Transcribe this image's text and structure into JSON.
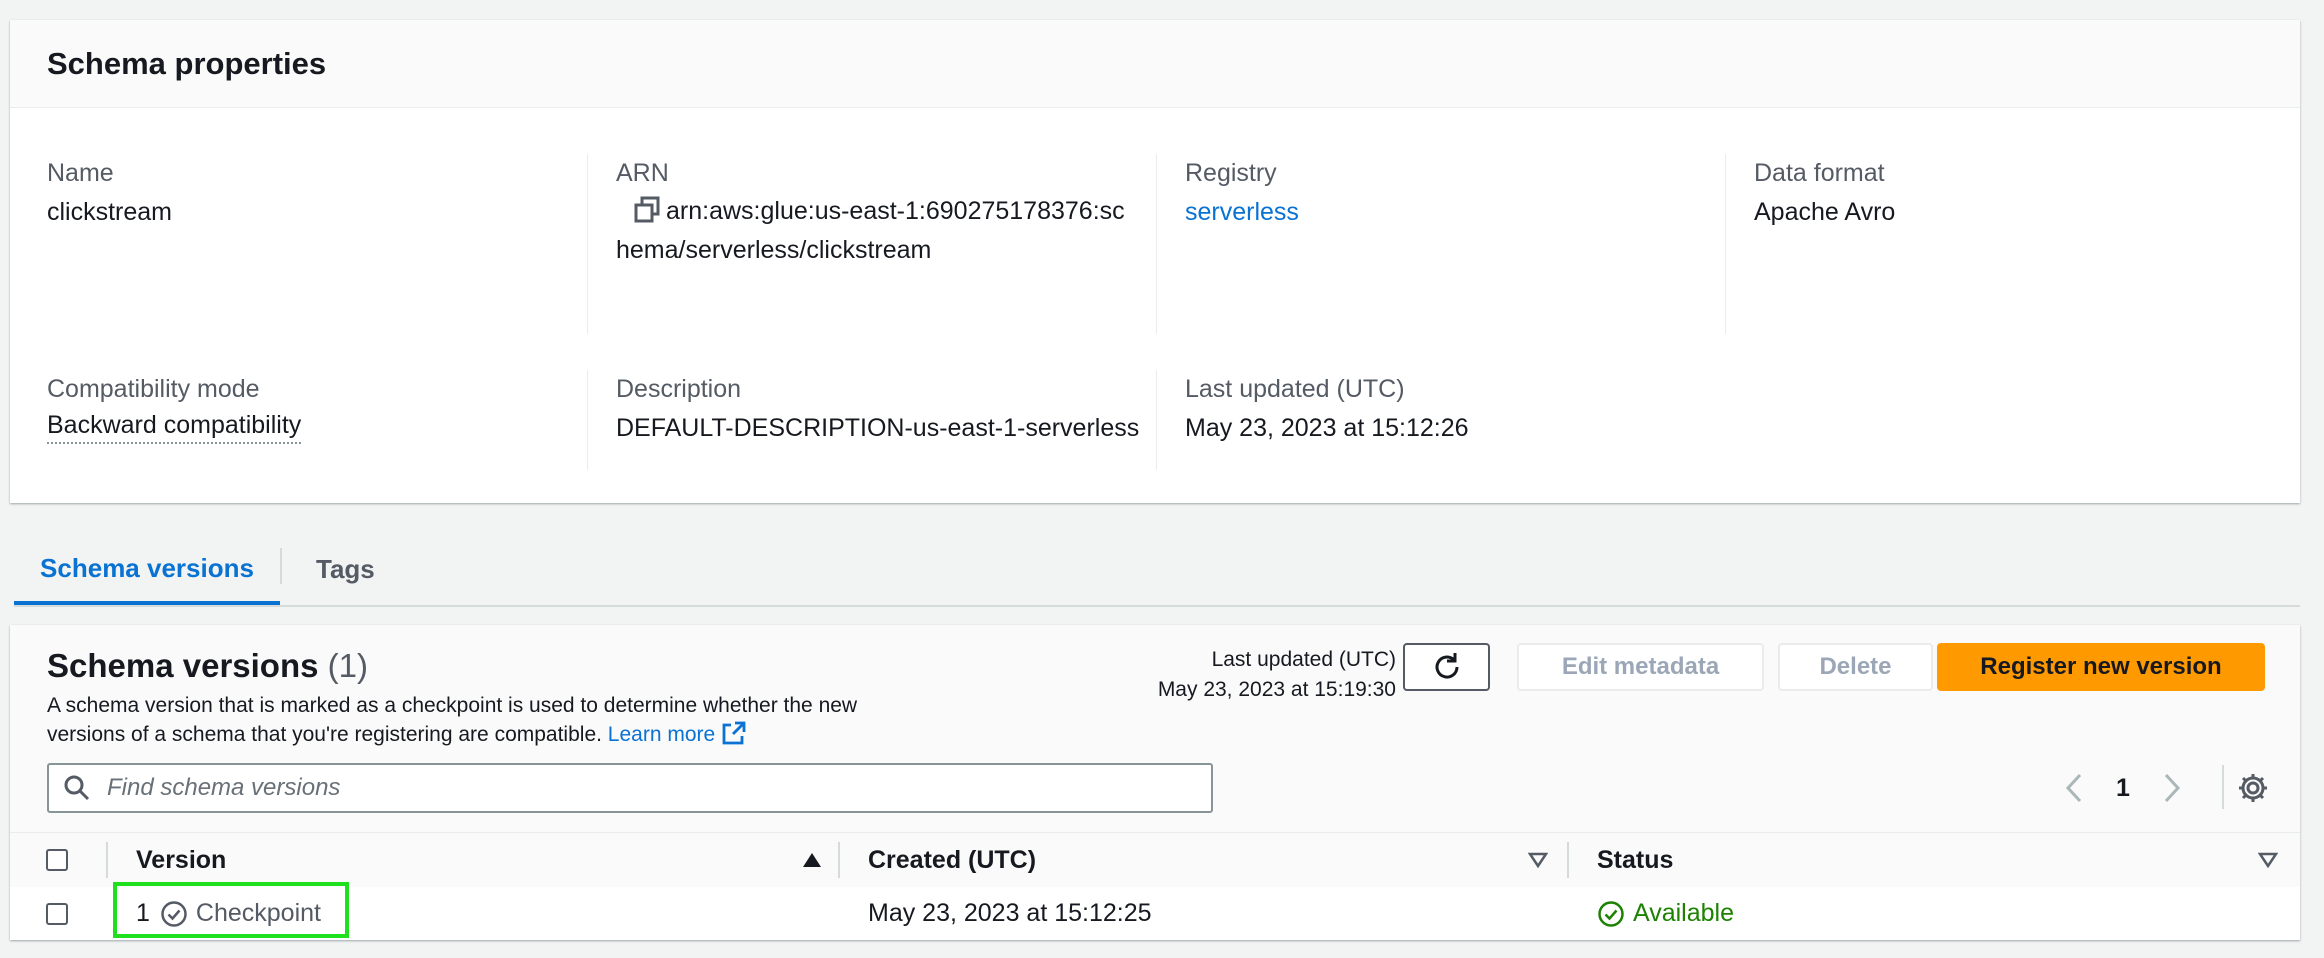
{
  "schema_properties": {
    "title": "Schema properties",
    "name": {
      "label": "Name",
      "value": "clickstream"
    },
    "arn": {
      "label": "ARN",
      "value": "arn:aws:glue:us-east-1:690275178376:schema/serverless/clickstream",
      "copy_icon": "copy-icon"
    },
    "registry": {
      "label": "Registry",
      "value": "serverless"
    },
    "data_format": {
      "label": "Data format",
      "value": "Apache Avro"
    },
    "compatibility_mode": {
      "label": "Compatibility mode",
      "value": "Backward compatibility"
    },
    "description": {
      "label": "Description",
      "value": "DEFAULT-DESCRIPTION-us-east-1-serverless"
    },
    "last_updated": {
      "label": "Last updated (UTC)",
      "value": "May 23, 2023 at 15:12:26"
    }
  },
  "tabs": [
    {
      "label": "Schema versions",
      "active": true
    },
    {
      "label": "Tags",
      "active": false
    }
  ],
  "schema_versions": {
    "title": "Schema versions",
    "count": "(1)",
    "description": "A schema version that is marked as a checkpoint is used to determine whether the new versions of a schema that you're registering are compatible.",
    "learn_more": "Learn more",
    "last_updated_label": "Last updated (UTC)",
    "last_updated_value": "May 23, 2023 at 15:19:30",
    "buttons": {
      "refresh_icon": "refresh-icon",
      "edit_metadata": "Edit metadata",
      "delete": "Delete",
      "register_new_version": "Register new version"
    },
    "search": {
      "placeholder": "Find schema versions",
      "value": ""
    },
    "pagination": {
      "current_page": "1"
    },
    "columns": [
      {
        "label": "Version",
        "sort": "ascending"
      },
      {
        "label": "Created (UTC)",
        "sort": "none"
      },
      {
        "label": "Status",
        "sort": "none"
      }
    ],
    "rows": [
      {
        "version": "1",
        "checkpoint_label": "Checkpoint",
        "created": "May 23, 2023 at 15:12:25",
        "status": "Available"
      }
    ]
  },
  "colors": {
    "link": "#0972d3",
    "primary_button": "#ff9900",
    "status_available": "#1d8102",
    "highlight": "#1fe01f"
  }
}
